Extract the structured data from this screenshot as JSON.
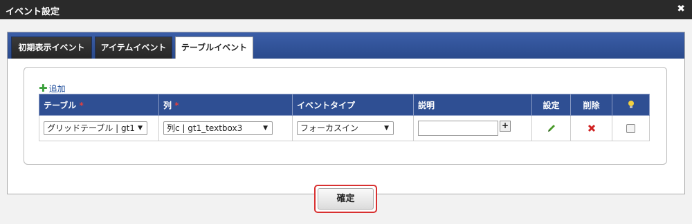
{
  "dialog": {
    "title": "イベント設定",
    "close_icon": "✖"
  },
  "tabs": [
    {
      "label": "初期表示イベント",
      "active": false
    },
    {
      "label": "アイテムイベント",
      "active": false
    },
    {
      "label": "テーブルイベント",
      "active": true
    }
  ],
  "add_link": {
    "icon": "plus-icon",
    "label": "追加"
  },
  "table": {
    "headers": {
      "table": "テーブル",
      "column": "列",
      "event_type": "イベントタイプ",
      "description": "説明",
      "settings": "設定",
      "delete": "削除",
      "hint_icon": "lightbulb-icon"
    },
    "required_mark": "*",
    "rows": [
      {
        "table": "グリッドテーブル | gt1",
        "column": "列c | gt1_textbox3",
        "event_type": "フォーカスイン",
        "description": "",
        "settings_icon": "pencil-icon",
        "delete_icon": "cross-icon",
        "checked": false
      }
    ]
  },
  "footer": {
    "confirm_label": "確定"
  },
  "colors": {
    "header_bg": "#2f4f93",
    "tabbar_bg": "#2a4a8c",
    "highlight": "#d83030"
  }
}
